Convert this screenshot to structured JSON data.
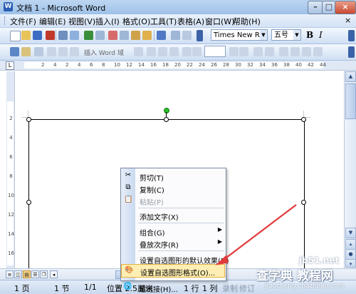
{
  "window": {
    "title": "文档 1 - Microsoft Word",
    "app_icon": "W"
  },
  "menubar": {
    "items": [
      "文件(F)",
      "编辑(E)",
      "视图(V)",
      "插入(I)",
      "格式(O)",
      "工具(T)",
      "表格(A)",
      "窗口(W)",
      "帮助(H)"
    ],
    "close_glyph": "×"
  },
  "toolbar": {
    "font_name": "Times New Roman",
    "font_size": "五号",
    "bold_label": "B",
    "italic_label": "I",
    "insert_word_field": "插入 Word 域"
  },
  "ruler": {
    "marks": [
      "2",
      "4",
      "2",
      "4",
      "6",
      "8",
      "10",
      "12",
      "14",
      "16",
      "18",
      "20",
      "22",
      "24",
      "26",
      "28",
      "30",
      "32",
      "34",
      "36",
      "38",
      "40",
      "42",
      "44"
    ],
    "vmarks": [
      "2",
      "4",
      "6",
      "8",
      "10",
      "12",
      "14",
      "16"
    ]
  },
  "context_menu": {
    "items": [
      {
        "icon": "scissors-icon",
        "label": "剪切(T)",
        "disabled": false
      },
      {
        "icon": "copy-icon",
        "label": "复制(C)",
        "disabled": false
      },
      {
        "icon": "paste-icon",
        "label": "粘贴(P)",
        "disabled": true
      },
      {
        "icon": "",
        "label": "添加文字(X)",
        "disabled": false
      },
      {
        "icon": "",
        "label": "组合(G)",
        "disabled": false,
        "submenu": true
      },
      {
        "icon": "",
        "label": "叠放次序(R)",
        "disabled": false,
        "submenu": true
      },
      {
        "icon": "",
        "label": "设置自选图形的默认效果(D)",
        "disabled": false
      },
      {
        "icon": "format-shape-icon",
        "label": "设置自选图形格式(O)...",
        "disabled": false,
        "highlighted": true
      },
      {
        "icon": "hyperlink-icon",
        "label": "超链接(H)...",
        "disabled": false
      }
    ]
  },
  "statusbar": {
    "page": "1 页",
    "section": "1 节",
    "page_of": "1/1",
    "position": "位置 2.5厘米",
    "line": "1 行",
    "column": "1 列",
    "rec": "录制",
    "trk": "修订"
  },
  "watermark": {
    "main": "查字典 教程网",
    "site": "jiaocheng.chazidian.com",
    "corner": "jb51.net"
  },
  "colors": {
    "title_bar": "#bcd6f1",
    "menu_highlight": "#ffeeb3",
    "arrow": "#e03a3a",
    "rotate_handle": "#2bbf2b"
  }
}
